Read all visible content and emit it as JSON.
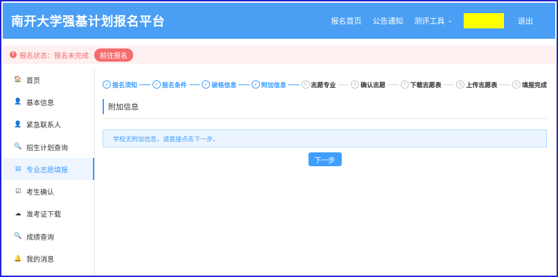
{
  "header": {
    "title": "南开大学强基计划报名平台",
    "nav": [
      {
        "label": "报名首页"
      },
      {
        "label": "公告通知"
      },
      {
        "label": "测评工具"
      }
    ],
    "dropdown_icon": "chevron-down-icon",
    "logout": "退出",
    "colors": {
      "bar": "#4a9ff5",
      "redacted_user": "#ffff00"
    }
  },
  "alert": {
    "status": "报名状态：报名未完成",
    "action": "前往报名",
    "icon": "exclamation-icon",
    "colors": {
      "text": "#f56c6c",
      "background": "#fef0f0"
    }
  },
  "sidebar": {
    "items": [
      {
        "label": "首页",
        "icon": "home-icon",
        "glyph": "🏠"
      },
      {
        "label": "基本信息",
        "icon": "user-icon",
        "glyph": "👤"
      },
      {
        "label": "紧急联系人",
        "icon": "user-icon",
        "glyph": "👤"
      },
      {
        "label": "招生计划查询",
        "icon": "search-icon",
        "glyph": "🔍"
      },
      {
        "label": "专业志愿填报",
        "icon": "list-icon",
        "glyph": "▤"
      },
      {
        "label": "考生确认",
        "icon": "checkbox-icon",
        "glyph": "☑"
      },
      {
        "label": "准考证下载",
        "icon": "cloud-download-icon",
        "glyph": "☁"
      },
      {
        "label": "成绩查询",
        "icon": "search-icon",
        "glyph": "🔍"
      },
      {
        "label": "我的消息",
        "icon": "bell-icon",
        "glyph": "🔔"
      }
    ],
    "active_index": 4
  },
  "steps": [
    {
      "label": "报名须知",
      "status": "done",
      "mark": "✓"
    },
    {
      "label": "报名条件",
      "status": "done",
      "mark": "✓"
    },
    {
      "label": "破格信息",
      "status": "done",
      "mark": "✓"
    },
    {
      "label": "附加信息",
      "status": "done",
      "mark": "✓"
    },
    {
      "label": "志愿专业",
      "status": "todo",
      "mark": "5"
    },
    {
      "label": "确认志愿",
      "status": "todo",
      "mark": "6"
    },
    {
      "label": "下载志愿表",
      "status": "todo",
      "mark": "7"
    },
    {
      "label": "上传志愿表",
      "status": "todo",
      "mark": "8"
    },
    {
      "label": "填报完成",
      "status": "todo",
      "mark": "9"
    }
  ],
  "main": {
    "section_title": "附加信息",
    "info_text": "学校无附加信息，请直接点击下一步。",
    "next_button": "下一步",
    "accent": "#409eff"
  }
}
